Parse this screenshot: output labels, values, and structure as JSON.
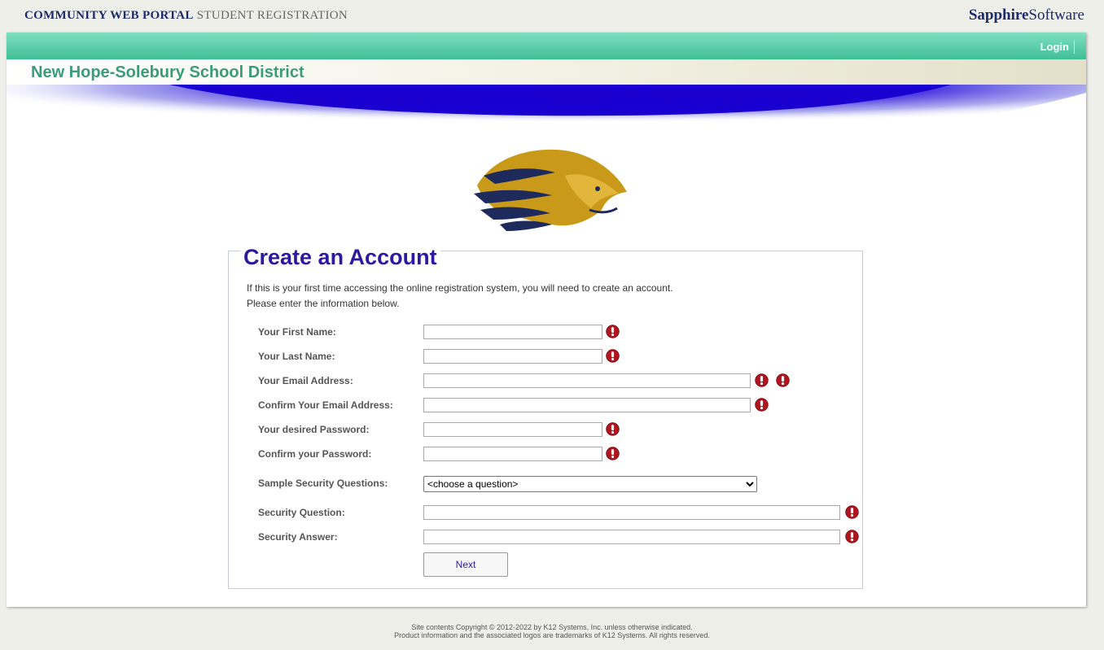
{
  "header": {
    "portal_title": "COMMUNITY WEB PORTAL",
    "portal_subtitle": "STUDENT REGISTRATION",
    "brand_bold": "Sapphire",
    "brand_light": "Software"
  },
  "nav": {
    "login_label": "Login"
  },
  "district_name": "New Hope-Solebury School District",
  "form": {
    "title": "Create an Account",
    "intro_line1": "If this is your first time accessing the online registration system, you will need to create an account.",
    "intro_line2": "Please enter the information below.",
    "first_name_label": "Your First Name:",
    "last_name_label": "Your Last Name:",
    "email_label": "Your Email Address:",
    "confirm_email_label": "Confirm Your Email Address:",
    "password_label": "Your desired Password:",
    "confirm_password_label": "Confirm your Password:",
    "sample_questions_label": "Sample Security Questions:",
    "sample_questions_selected": "<choose a question>",
    "security_question_label": "Security Question:",
    "security_answer_label": "Security Answer:",
    "first_name_value": "",
    "last_name_value": "",
    "email_value": "",
    "confirm_email_value": "",
    "password_value": "",
    "confirm_password_value": "",
    "security_question_value": "",
    "security_answer_value": "",
    "next_label": "Next"
  },
  "footer": {
    "line1": "Site contents Copyright © 2012-2022 by K12 Systems, Inc. unless otherwise indicated.",
    "line2": "Product information and the associated logos are trademarks of K12 Systems.  All rights reserved."
  },
  "colors": {
    "accent_green": "#3fbf95",
    "title_blue": "#2b1aa0",
    "required_red": "#b0141e"
  }
}
